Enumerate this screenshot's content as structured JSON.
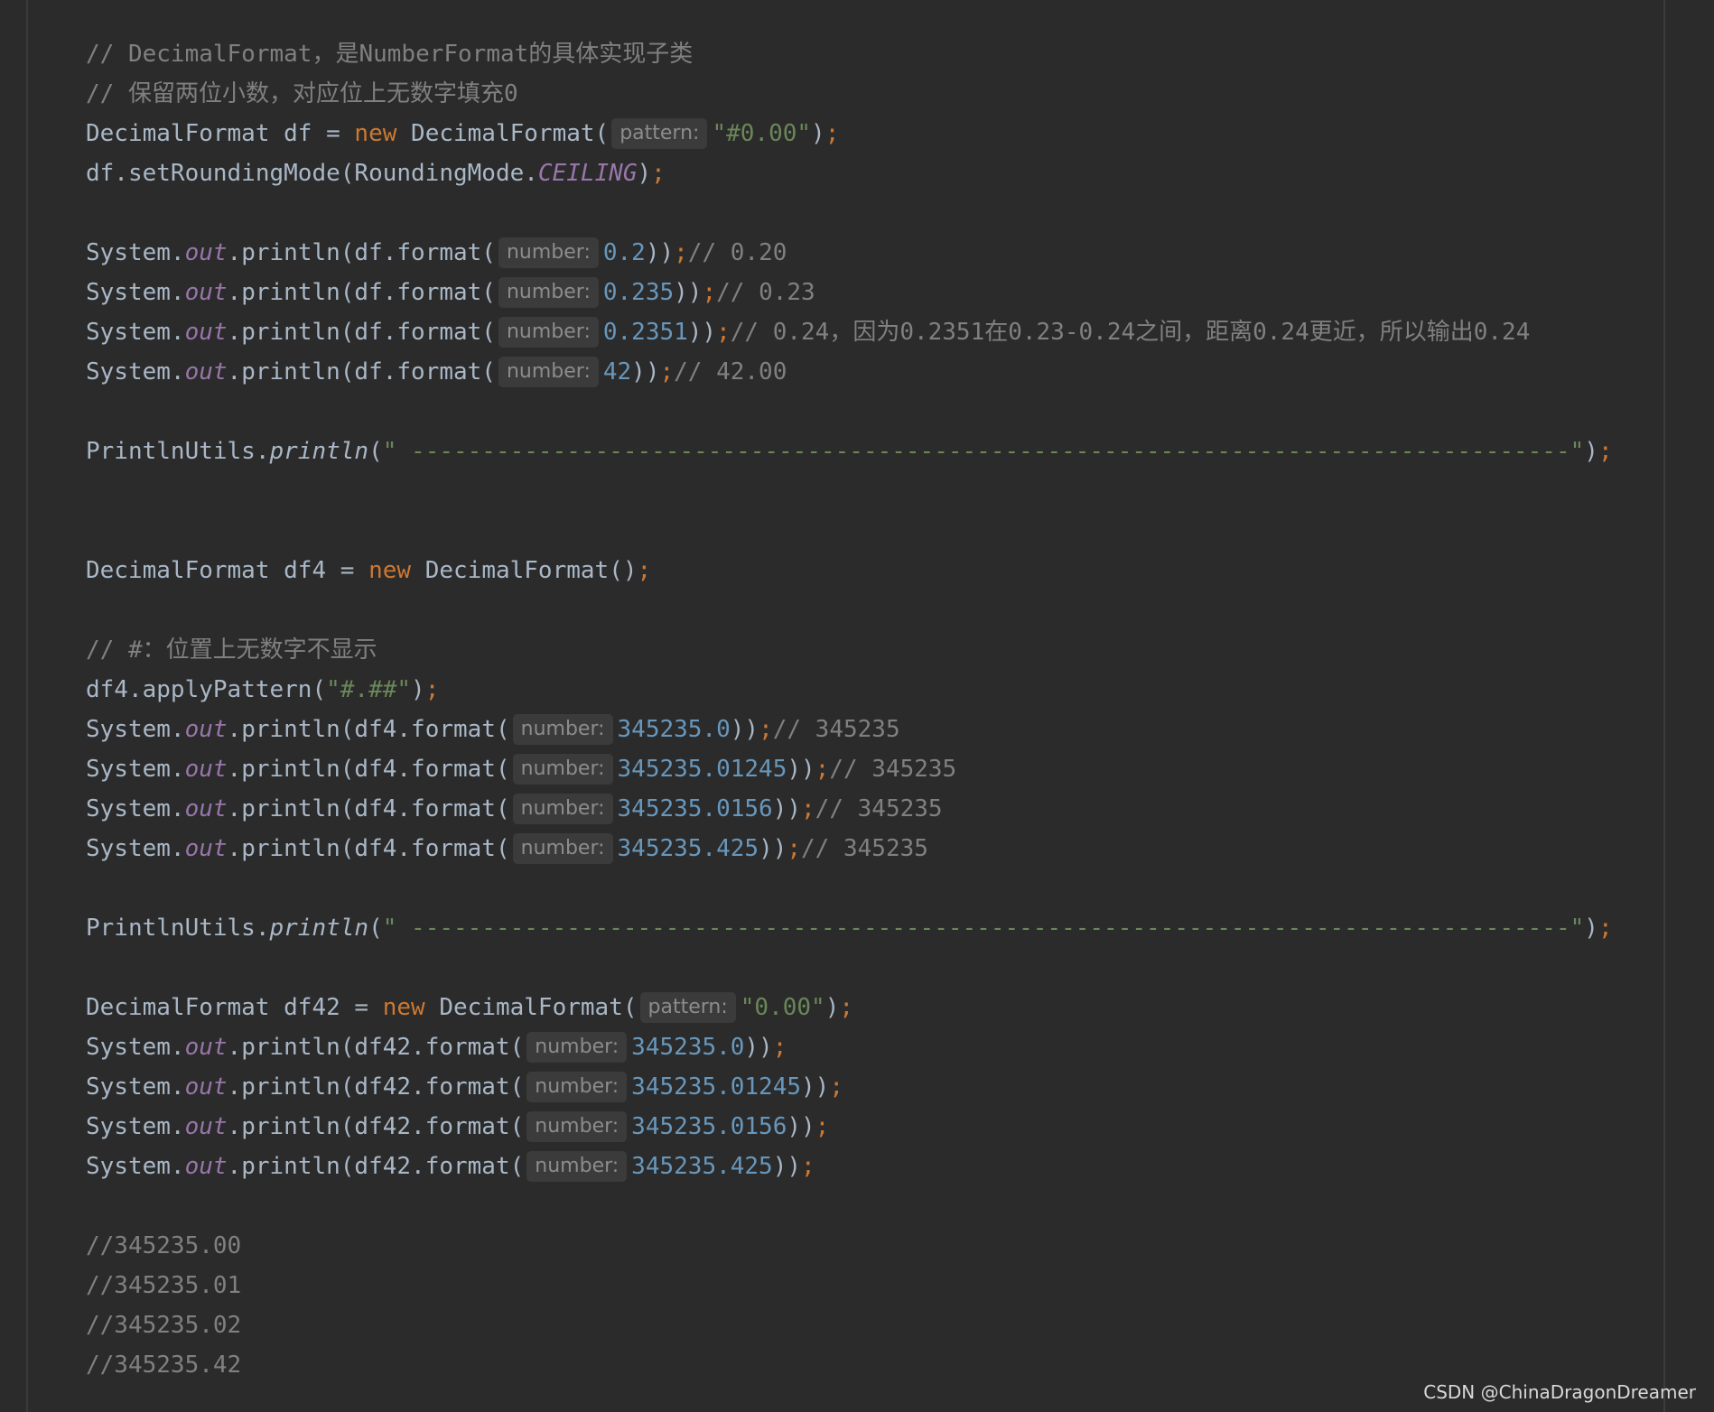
{
  "code": {
    "lines": [
      [
        {
          "t": "// DecimalFormat，是NumberFormat的具体实现子类",
          "c": "cm"
        }
      ],
      [
        {
          "t": "// 保留两位小数，对应位上无数字填充0",
          "c": "cm"
        }
      ],
      [
        {
          "t": "DecimalFormat df = ",
          "c": "pl"
        },
        {
          "t": "new",
          "c": "kw"
        },
        {
          "t": " DecimalFormat(",
          "c": "pl"
        },
        {
          "t": "pattern:",
          "c": "hint"
        },
        {
          "t": "\"#0.00\"",
          "c": "str"
        },
        {
          "t": ")",
          "c": "pl"
        },
        {
          "t": ";",
          "c": "semi"
        }
      ],
      [
        {
          "t": "df.setRoundingMode(RoundingMode.",
          "c": "pl"
        },
        {
          "t": "CEILING",
          "c": "fld"
        },
        {
          "t": ")",
          "c": "pl"
        },
        {
          "t": ";",
          "c": "semi"
        }
      ],
      [],
      [
        {
          "t": "System.",
          "c": "pl"
        },
        {
          "t": "out",
          "c": "fld"
        },
        {
          "t": ".println(df.format(",
          "c": "pl"
        },
        {
          "t": "number:",
          "c": "hint"
        },
        {
          "t": "0.2",
          "c": "num"
        },
        {
          "t": "))",
          "c": "pl"
        },
        {
          "t": ";",
          "c": "semi"
        },
        {
          "t": "// 0.20",
          "c": "cm"
        }
      ],
      [
        {
          "t": "System.",
          "c": "pl"
        },
        {
          "t": "out",
          "c": "fld"
        },
        {
          "t": ".println(df.format(",
          "c": "pl"
        },
        {
          "t": "number:",
          "c": "hint"
        },
        {
          "t": "0.235",
          "c": "num"
        },
        {
          "t": "))",
          "c": "pl"
        },
        {
          "t": ";",
          "c": "semi"
        },
        {
          "t": "// 0.23",
          "c": "cm"
        }
      ],
      [
        {
          "t": "System.",
          "c": "pl"
        },
        {
          "t": "out",
          "c": "fld"
        },
        {
          "t": ".println(df.format(",
          "c": "pl"
        },
        {
          "t": "number:",
          "c": "hint"
        },
        {
          "t": "0.2351",
          "c": "num"
        },
        {
          "t": "))",
          "c": "pl"
        },
        {
          "t": ";",
          "c": "semi"
        },
        {
          "t": "// 0.24，因为0.2351在0.23-0.24之间，距离0.24更近，所以输出0.24",
          "c": "cm"
        }
      ],
      [
        {
          "t": "System.",
          "c": "pl"
        },
        {
          "t": "out",
          "c": "fld"
        },
        {
          "t": ".println(df.format(",
          "c": "pl"
        },
        {
          "t": "number:",
          "c": "hint"
        },
        {
          "t": "42",
          "c": "num"
        },
        {
          "t": "))",
          "c": "pl"
        },
        {
          "t": ";",
          "c": "semi"
        },
        {
          "t": "// 42.00",
          "c": "cm"
        }
      ],
      [],
      [
        {
          "t": "PrintlnUtils.",
          "c": "pl"
        },
        {
          "t": "println",
          "c": "ital"
        },
        {
          "t": "(",
          "c": "pl"
        },
        {
          "t": "\" ----------------------------------------------------------------------------------\"",
          "c": "str"
        },
        {
          "t": ")",
          "c": "pl"
        },
        {
          "t": ";",
          "c": "semi"
        }
      ],
      [],
      [],
      [
        {
          "t": "DecimalFormat df4 = ",
          "c": "pl"
        },
        {
          "t": "new",
          "c": "kw"
        },
        {
          "t": " DecimalFormat()",
          "c": "pl"
        },
        {
          "t": ";",
          "c": "semi"
        }
      ],
      [],
      [
        {
          "t": "// #：位置上无数字不显示",
          "c": "cm"
        }
      ],
      [
        {
          "t": "df4.applyPattern(",
          "c": "pl"
        },
        {
          "t": "\"#.##\"",
          "c": "str"
        },
        {
          "t": ")",
          "c": "pl"
        },
        {
          "t": ";",
          "c": "semi"
        }
      ],
      [
        {
          "t": "System.",
          "c": "pl"
        },
        {
          "t": "out",
          "c": "fld"
        },
        {
          "t": ".println(df4.format(",
          "c": "pl"
        },
        {
          "t": "number:",
          "c": "hint"
        },
        {
          "t": "345235.0",
          "c": "num"
        },
        {
          "t": "))",
          "c": "pl"
        },
        {
          "t": ";",
          "c": "semi"
        },
        {
          "t": "// 345235",
          "c": "cm"
        }
      ],
      [
        {
          "t": "System.",
          "c": "pl"
        },
        {
          "t": "out",
          "c": "fld"
        },
        {
          "t": ".println(df4.format(",
          "c": "pl"
        },
        {
          "t": "number:",
          "c": "hint"
        },
        {
          "t": "345235.01245",
          "c": "num"
        },
        {
          "t": "))",
          "c": "pl"
        },
        {
          "t": ";",
          "c": "semi"
        },
        {
          "t": "// 345235",
          "c": "cm"
        }
      ],
      [
        {
          "t": "System.",
          "c": "pl"
        },
        {
          "t": "out",
          "c": "fld"
        },
        {
          "t": ".println(df4.format(",
          "c": "pl"
        },
        {
          "t": "number:",
          "c": "hint"
        },
        {
          "t": "345235.0156",
          "c": "num"
        },
        {
          "t": "))",
          "c": "pl"
        },
        {
          "t": ";",
          "c": "semi"
        },
        {
          "t": "// 345235",
          "c": "cm"
        }
      ],
      [
        {
          "t": "System.",
          "c": "pl"
        },
        {
          "t": "out",
          "c": "fld"
        },
        {
          "t": ".println(df4.format(",
          "c": "pl"
        },
        {
          "t": "number:",
          "c": "hint"
        },
        {
          "t": "345235.425",
          "c": "num"
        },
        {
          "t": "))",
          "c": "pl"
        },
        {
          "t": ";",
          "c": "semi"
        },
        {
          "t": "// 345235",
          "c": "cm"
        }
      ],
      [],
      [
        {
          "t": "PrintlnUtils.",
          "c": "pl"
        },
        {
          "t": "println",
          "c": "ital"
        },
        {
          "t": "(",
          "c": "pl"
        },
        {
          "t": "\" ----------------------------------------------------------------------------------\"",
          "c": "str"
        },
        {
          "t": ")",
          "c": "pl"
        },
        {
          "t": ";",
          "c": "semi"
        }
      ],
      [],
      [
        {
          "t": "DecimalFormat df42 = ",
          "c": "pl"
        },
        {
          "t": "new",
          "c": "kw"
        },
        {
          "t": " DecimalFormat(",
          "c": "pl"
        },
        {
          "t": "pattern:",
          "c": "hint"
        },
        {
          "t": "\"0.00\"",
          "c": "str"
        },
        {
          "t": ")",
          "c": "pl"
        },
        {
          "t": ";",
          "c": "semi"
        }
      ],
      [
        {
          "t": "System.",
          "c": "pl"
        },
        {
          "t": "out",
          "c": "fld"
        },
        {
          "t": ".println(df42.format(",
          "c": "pl"
        },
        {
          "t": "number:",
          "c": "hint"
        },
        {
          "t": "345235.0",
          "c": "num"
        },
        {
          "t": "))",
          "c": "pl"
        },
        {
          "t": ";",
          "c": "semi"
        }
      ],
      [
        {
          "t": "System.",
          "c": "pl"
        },
        {
          "t": "out",
          "c": "fld"
        },
        {
          "t": ".println(df42.format(",
          "c": "pl"
        },
        {
          "t": "number:",
          "c": "hint"
        },
        {
          "t": "345235.01245",
          "c": "num"
        },
        {
          "t": "))",
          "c": "pl"
        },
        {
          "t": ";",
          "c": "semi"
        }
      ],
      [
        {
          "t": "System.",
          "c": "pl"
        },
        {
          "t": "out",
          "c": "fld"
        },
        {
          "t": ".println(df42.format(",
          "c": "pl"
        },
        {
          "t": "number:",
          "c": "hint"
        },
        {
          "t": "345235.0156",
          "c": "num"
        },
        {
          "t": "))",
          "c": "pl"
        },
        {
          "t": ";",
          "c": "semi"
        }
      ],
      [
        {
          "t": "System.",
          "c": "pl"
        },
        {
          "t": "out",
          "c": "fld"
        },
        {
          "t": ".println(df42.format(",
          "c": "pl"
        },
        {
          "t": "number:",
          "c": "hint"
        },
        {
          "t": "345235.425",
          "c": "num"
        },
        {
          "t": "))",
          "c": "pl"
        },
        {
          "t": ";",
          "c": "semi"
        }
      ],
      [],
      [
        {
          "t": "//345235.00",
          "c": "cm"
        }
      ],
      [
        {
          "t": "//345235.01",
          "c": "cm"
        }
      ],
      [
        {
          "t": "//345235.02",
          "c": "cm"
        }
      ],
      [
        {
          "t": "//345235.42",
          "c": "cm"
        }
      ]
    ]
  },
  "watermark": "CSDN @ChinaDragonDreamer",
  "colors": {
    "background": "#2b2b2b",
    "plain": "#a9b7c6",
    "comment": "#808080",
    "keyword": "#cc7832",
    "string": "#6a8759",
    "number": "#6897bb",
    "field": "#9876aa",
    "hint_bg": "#3b3b3b",
    "hint_text": "#8c8c8c"
  }
}
